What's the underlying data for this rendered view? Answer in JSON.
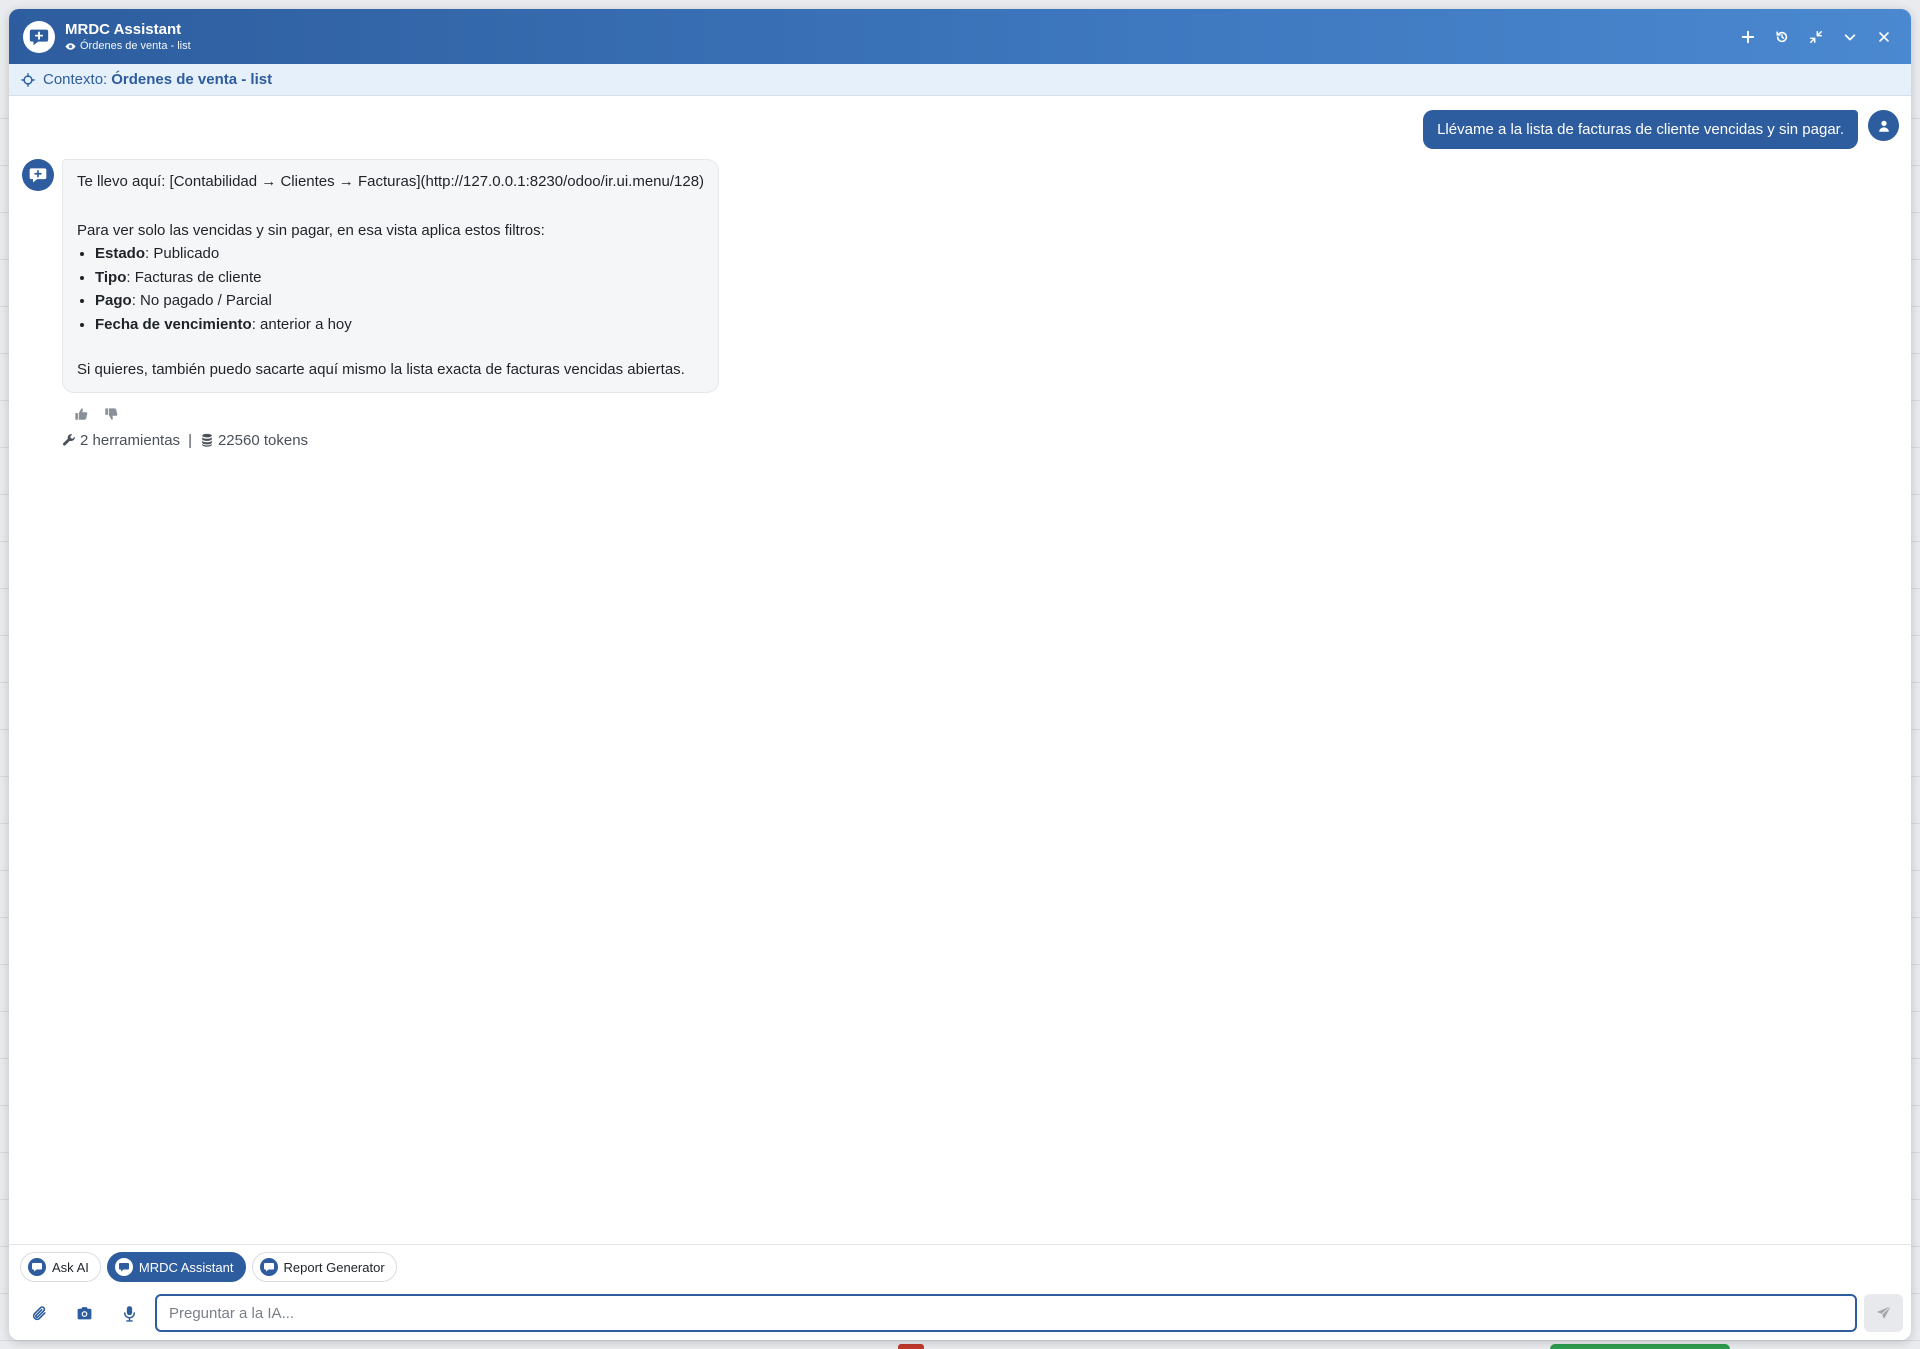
{
  "window": {
    "title": "MRDC Assistant",
    "subtitle": "Órdenes de venta - list"
  },
  "context": {
    "label": "Contexto:",
    "value": "Órdenes de venta - list"
  },
  "messages": {
    "user": "Llévame a la lista de facturas de cliente vencidas y sin pagar.",
    "bot": {
      "line1": "Te llevo aquí: [Contabilidad → Clientes → Facturas](http://127.0.0.1:8230/odoo/ir.ui.menu/128)",
      "intro": "Para ver solo las vencidas y sin pagar, en esa vista aplica estos filtros:",
      "filters": [
        {
          "key": "Estado",
          "value": ": Publicado"
        },
        {
          "key": "Tipo",
          "value": ": Facturas de cliente"
        },
        {
          "key": "Pago",
          "value": ": No pagado / Parcial"
        },
        {
          "key": "Fecha de vencimiento",
          "value": ": anterior a hoy"
        }
      ],
      "closing": "Si quieres, también puedo sacarte aquí mismo la lista exacta de facturas vencidas abiertas."
    },
    "meta": {
      "tools": "2 herramientas",
      "separator": "|",
      "tokens": "22560 tokens"
    }
  },
  "assistants": [
    {
      "label": "Ask AI",
      "active": false
    },
    {
      "label": "MRDC Assistant",
      "active": true
    },
    {
      "label": "Report Generator",
      "active": false
    }
  ],
  "composer": {
    "placeholder": "Preguntar a la IA..."
  },
  "colors": {
    "primary": "#2d5d9e",
    "header_gradient_end": "#4a88cf",
    "context_bg": "#e6f0fa",
    "bubble_bg": "#f5f6f8"
  },
  "icons": {
    "app": "chat-plus-icon",
    "subtitle": "eye-icon",
    "title_actions": [
      "plus-icon",
      "history-icon",
      "compress-icon",
      "chevron-down-icon",
      "close-icon"
    ],
    "context": "crosshair-icon",
    "user_avatar": "user-icon",
    "bot_avatar": "chat-plus-icon",
    "feedback": [
      "thumbs-up-icon",
      "thumbs-down-icon"
    ],
    "meta": [
      "wrench-icon",
      "database-icon"
    ],
    "composer": [
      "paperclip-icon",
      "camera-icon",
      "microphone-icon",
      "send-icon"
    ]
  }
}
